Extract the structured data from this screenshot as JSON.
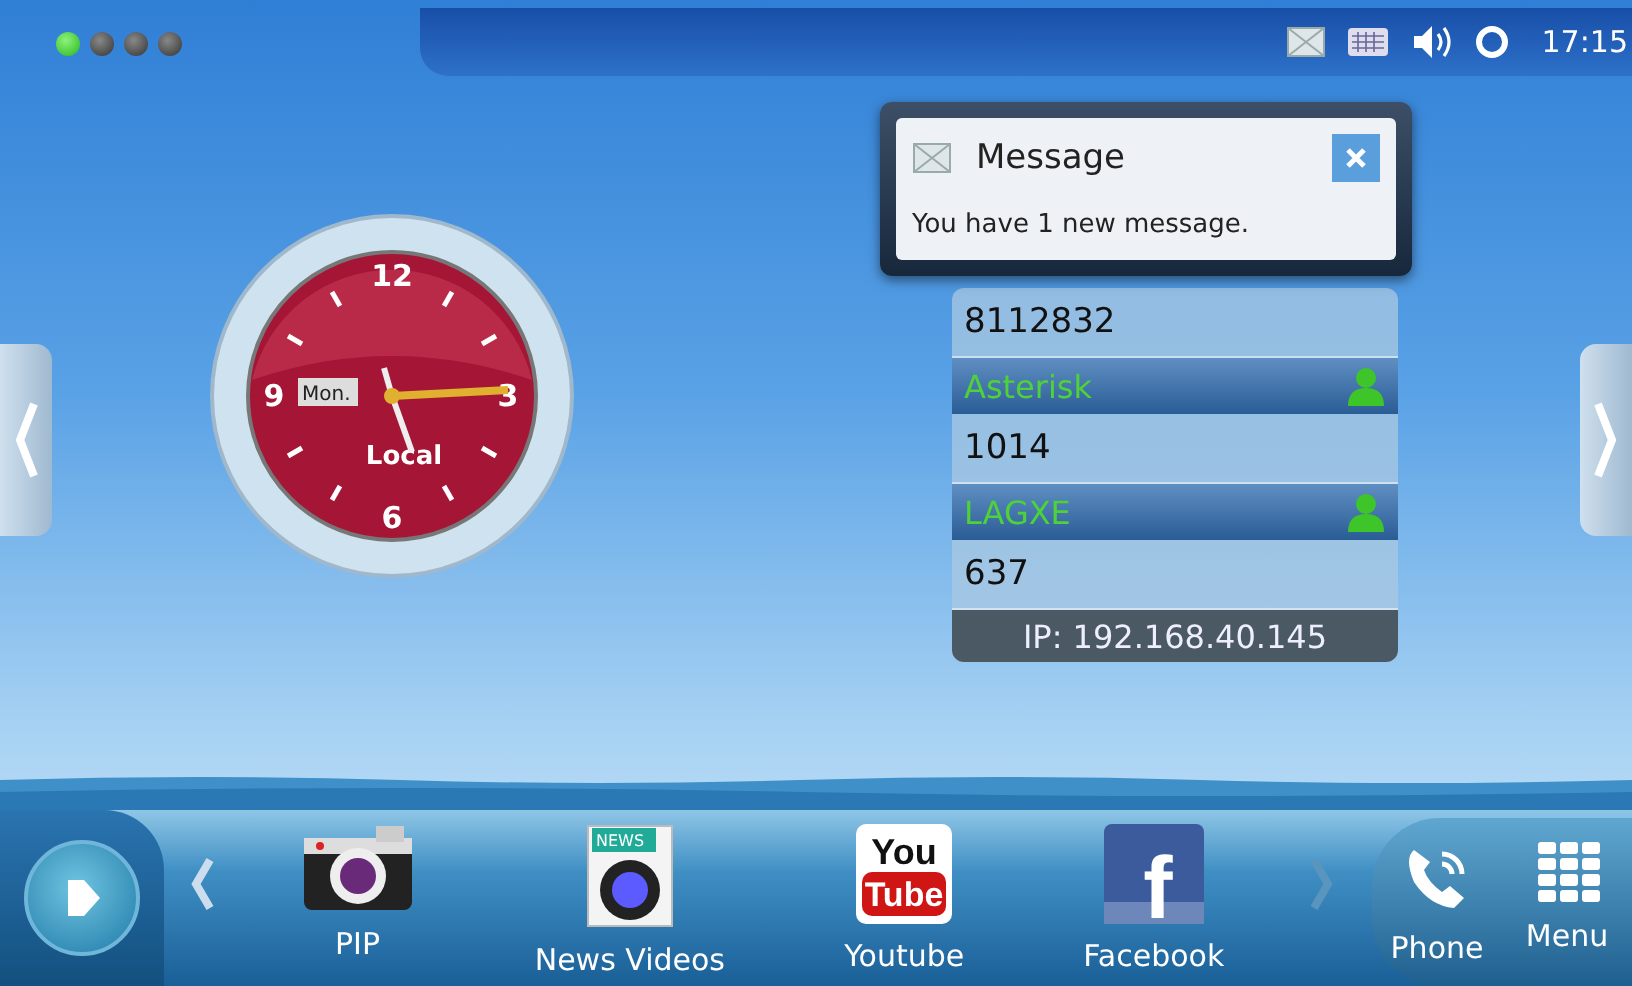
{
  "status_bar": {
    "page_dots": [
      {
        "selected": true
      },
      {
        "selected": false
      },
      {
        "selected": false
      },
      {
        "selected": false
      }
    ],
    "time": "17:15"
  },
  "clock": {
    "numerals": [
      "12",
      "3",
      "6",
      "9"
    ],
    "day": "Mon.",
    "label": "Local"
  },
  "accounts": [
    {
      "number": "8112832"
    },
    {
      "name": "Asterisk",
      "number": "1014",
      "registered": true
    },
    {
      "name": "LAGXE",
      "number": "637",
      "registered": true
    }
  ],
  "ip": "IP: 192.168.40.145",
  "notification": {
    "title": "Message",
    "text": "You have 1 new message."
  },
  "dock": {
    "apps": [
      {
        "kind": "camera",
        "label": "PIP"
      },
      {
        "kind": "news",
        "label": "News Videos",
        "icon_text": [
          "NEWS"
        ]
      },
      {
        "kind": "youtube",
        "label": "Youtube",
        "icon_text": [
          "You",
          "Tube"
        ]
      },
      {
        "kind": "facebook",
        "label": "Facebook",
        "icon_text": [
          "f"
        ]
      }
    ],
    "buttons": [
      {
        "kind": "phone",
        "label": "Phone"
      },
      {
        "kind": "menu",
        "label": "Menu"
      }
    ]
  }
}
